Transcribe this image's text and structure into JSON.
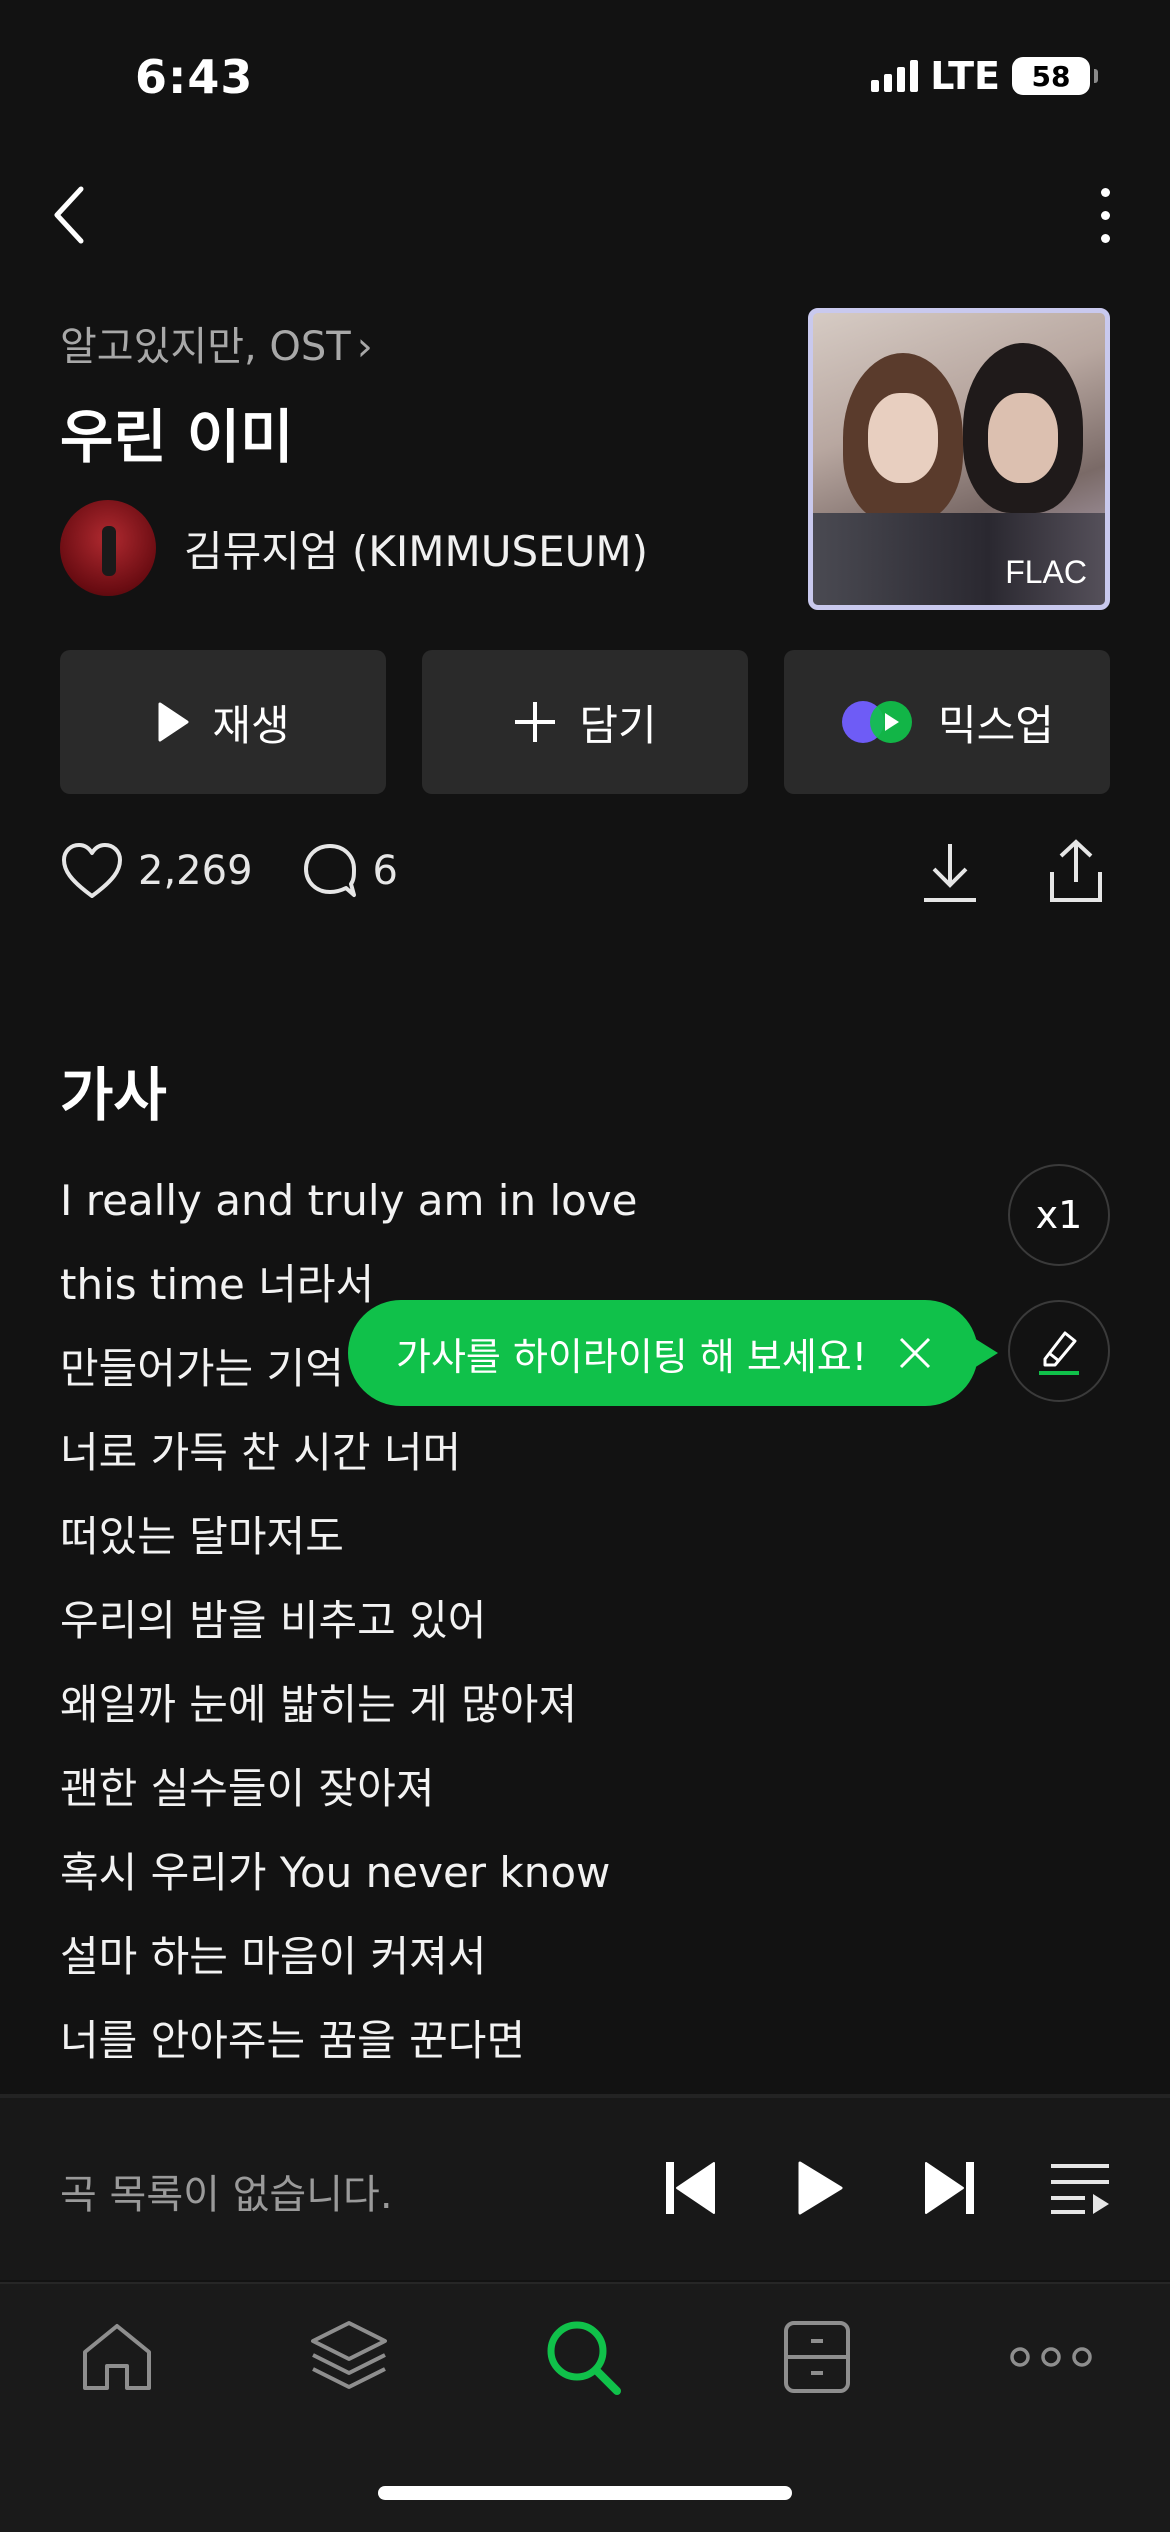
{
  "status_bar": {
    "time": "6:43",
    "network": "LTE",
    "battery": "58"
  },
  "song": {
    "album": "알고있지만, OST",
    "album_chevron": "›",
    "title": "우린 이미",
    "artist": "김뮤지엄 (KIMMUSEUM)",
    "quality_badge": "FLAC"
  },
  "actions": {
    "play": "재생",
    "add": "담기",
    "mixup": "믹스업"
  },
  "stats": {
    "likes": "2,269",
    "comments": "6"
  },
  "lyrics": {
    "heading": "가사",
    "lines": [
      "I really and truly am in love",
      "this time 너라서",
      "만들어가는 기억",
      "너로 가득 찬 시간 너머",
      "떠있는 달마저도",
      "우리의 밤을 비추고 있어",
      "왜일까 눈에 밟히는 게 많아져",
      "괜한 실수들이 잦아져",
      "혹시 우리가 You never know",
      "설마 하는 마음이 커져서",
      "너를 안아주는 꿈을 꾼다면"
    ],
    "speed": "x1",
    "tooltip": "가사를 하이라이팅 해 보세요!"
  },
  "mini_player": {
    "empty_text": "곡 목록이 없습니다."
  },
  "tabs": [
    {
      "icon": "home-icon"
    },
    {
      "icon": "layers-icon"
    },
    {
      "icon": "search-icon",
      "active": true
    },
    {
      "icon": "drawer-icon"
    },
    {
      "icon": "more-icon"
    }
  ],
  "colors": {
    "accent": "#10c14a",
    "background": "#121212",
    "button_bg": "#2a2a2a"
  }
}
